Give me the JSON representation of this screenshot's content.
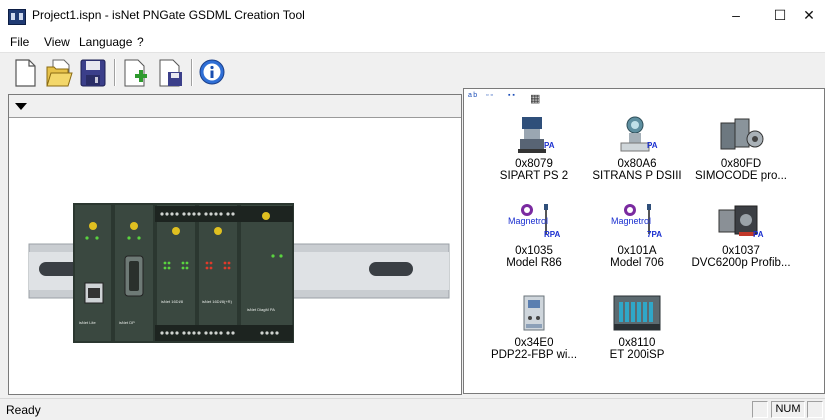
{
  "window": {
    "title": "Project1.ispn - isNet PNGate GSDML Creation Tool",
    "controls": {
      "minimize": "–",
      "maximize": "☐",
      "close": "✕"
    }
  },
  "menu": [
    "File",
    "View",
    "Language",
    "?"
  ],
  "toolbar": {
    "buttons": [
      "new-file-icon",
      "open-folder-icon",
      "save-disk-icon",
      "add-document-icon",
      "export-document-icon",
      "info-icon"
    ]
  },
  "left_panel": {
    "selector": ""
  },
  "right_panel": {
    "view_modes": [
      "large-icons-icon",
      "small-icons-icon",
      "list-icon",
      "details-icon"
    ],
    "view_mode_glyphs": [
      "a b",
      "▫ ▫",
      "▪ ▪",
      "▦"
    ],
    "devices": [
      {
        "code": "0x8079",
        "name": "SIPART PS 2",
        "badge": "PA"
      },
      {
        "code": "0x80A6",
        "name": "SITRANS P DSIII",
        "badge": "PA"
      },
      {
        "code": "0x80FD",
        "name": "SIMOCODE pro...",
        "badge": ""
      },
      {
        "code": "0x1035",
        "name": "Model R86",
        "badge": "RPA",
        "brand": "Magnetrol"
      },
      {
        "code": "0x101A",
        "name": "Model 706",
        "badge": "7PA",
        "brand": "Magnetrol"
      },
      {
        "code": "0x1037",
        "name": "DVC6200p Profib...",
        "badge": "PA"
      },
      {
        "code": "0x34E0",
        "name": "PDP22-FBP wi...",
        "badge": ""
      },
      {
        "code": "0x8110",
        "name": "ET 200iSP",
        "badge": ""
      }
    ]
  },
  "hardware": {
    "modules": [
      {
        "label": "isNet Lite",
        "sublabel": "Ethernet Gateway"
      },
      {
        "label": "isNet DP",
        "sublabel": "PROFIBUS DP Interface"
      },
      {
        "label": "isNet 16DI/8",
        "sublabel": "Digital Inputs"
      },
      {
        "label": "isNet 16DI/8(+R)",
        "sublabel": "Digital Inputs"
      },
      {
        "label": "isNet DiagM PA",
        "sublabel": "Diagnostic Module"
      }
    ],
    "colors": {
      "module": "#2b3730",
      "module_face": "#3a4840",
      "accent": "#e0c020",
      "led_green": "#5ad33f",
      "led_red": "#e03a2a",
      "rail": "#c9cdd1"
    }
  },
  "statusbar": {
    "text": "Ready",
    "indicator": "NUM"
  }
}
